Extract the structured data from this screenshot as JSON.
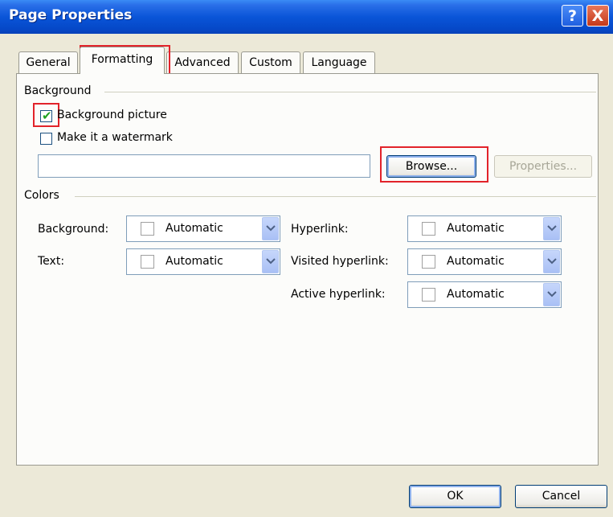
{
  "window": {
    "title": "Page Properties"
  },
  "titlebar_buttons": {
    "help": "?",
    "close": "X"
  },
  "tabs": [
    {
      "label": "General"
    },
    {
      "label": "Formatting"
    },
    {
      "label": "Advanced"
    },
    {
      "label": "Custom"
    },
    {
      "label": "Language"
    }
  ],
  "active_tab": "Formatting",
  "background_group": {
    "label": "Background",
    "background_picture": {
      "label": "Background picture",
      "checked": true
    },
    "watermark": {
      "label": "Make it a watermark",
      "checked": false
    },
    "picture_path": "",
    "browse_label": "Browse...",
    "properties_label": "Properties..."
  },
  "colors_group": {
    "label": "Colors",
    "background": {
      "label": "Background:",
      "value": "Automatic"
    },
    "text": {
      "label": "Text:",
      "value": "Automatic"
    },
    "hyperlink": {
      "label": "Hyperlink:",
      "value": "Automatic"
    },
    "visited_hyperlink": {
      "label": "Visited hyperlink:",
      "value": "Automatic"
    },
    "active_hyperlink": {
      "label": "Active hyperlink:",
      "value": "Automatic"
    }
  },
  "footer": {
    "ok_label": "OK",
    "cancel_label": "Cancel"
  },
  "colors": {
    "titlebar": "#0a55d8",
    "highlight": "#e2232a",
    "check": "#21a121",
    "dialog_bg": "#ECE9D8"
  }
}
